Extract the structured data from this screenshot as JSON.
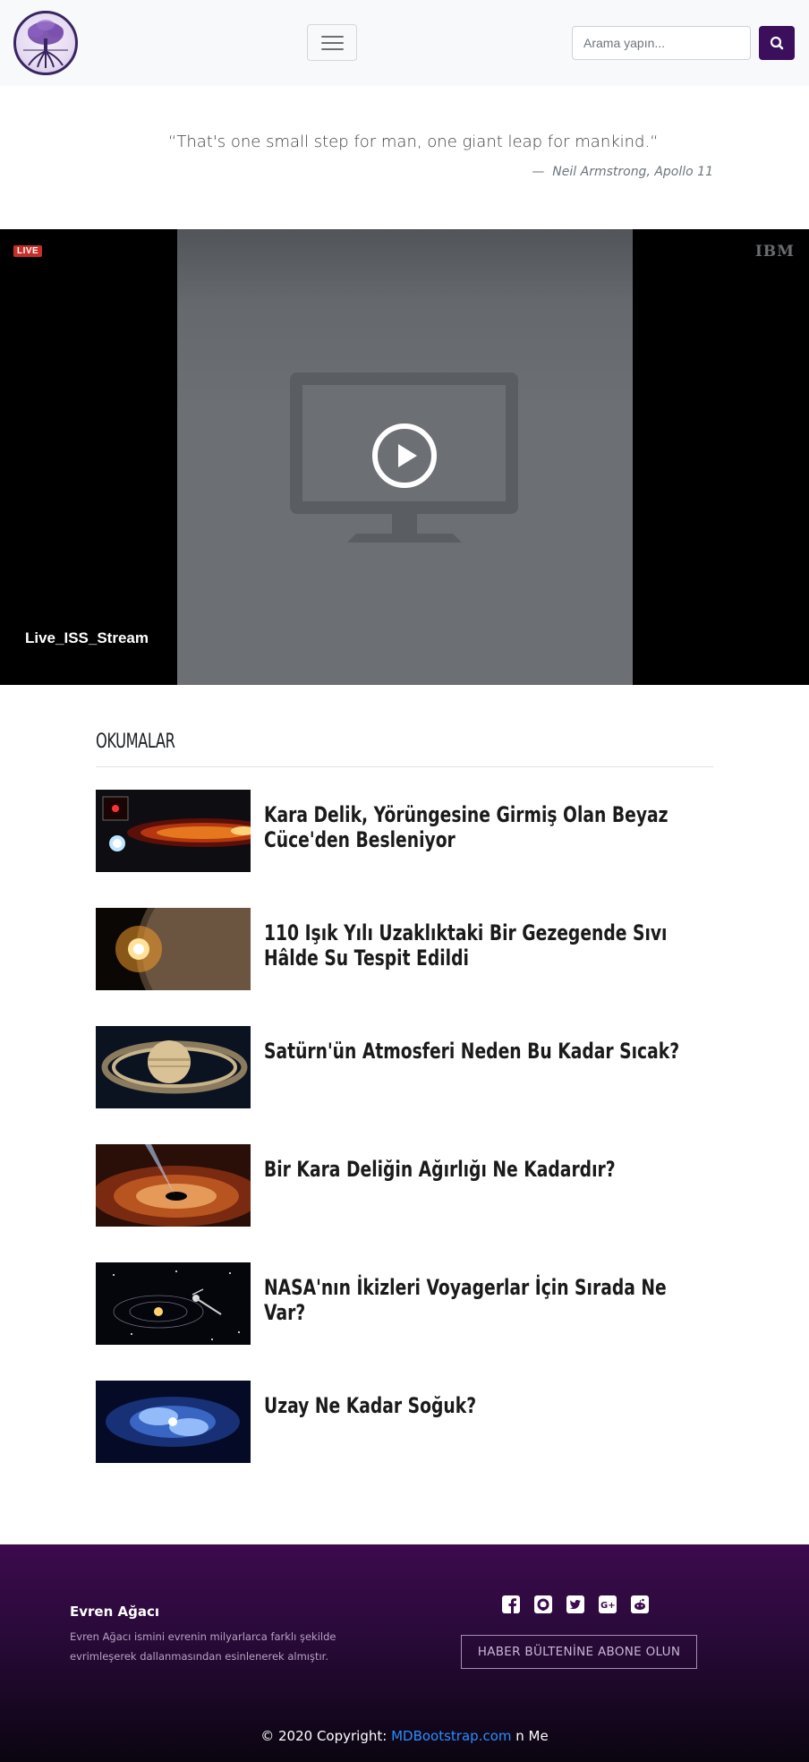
{
  "navbar": {
    "logo_alt": "Evren Ağacı",
    "search_placeholder": "Arama yapın..."
  },
  "quote": {
    "text": "“That's one small step for man, one giant leap for mankind.“",
    "dash": "—",
    "source": "Neil Armstrong, Apollo 11"
  },
  "video": {
    "live_label": "LIVE",
    "brand": "IBM",
    "stream_name": "Live_ISS_Stream"
  },
  "articles": {
    "heading": "OKUMALAR",
    "items": [
      {
        "title": "Kara Delik, Yörüngesine Girmiş Olan Beyaz Cüce'den Besleniyor",
        "thumb": "black-hole-white-dwarf"
      },
      {
        "title": "110 Işık Yılı Uzaklıktaki Bir Gezegende Sıvı Hâlde Su Tespit Edildi",
        "thumb": "exoplanet-sunrise"
      },
      {
        "title": "Satürn'ün Atmosferi Neden Bu Kadar Sıcak?",
        "thumb": "saturn"
      },
      {
        "title": "Bir Kara Deliğin Ağırlığı Ne Kadardır?",
        "thumb": "black-hole-accretion-disk"
      },
      {
        "title": "NASA'nın İkizleri Voyagerlar İçin Sırada Ne Var?",
        "thumb": "voyager-solar-system"
      },
      {
        "title": "Uzay Ne Kadar Soğuk?",
        "thumb": "boomerang-nebula"
      }
    ]
  },
  "footer": {
    "title": "Evren Ağacı",
    "description": "Evren Ağacı ismini evrenin milyarlarca farklı şekilde evrimleşerek dallanmasından esinlenerek almıştır.",
    "social_icons": [
      "facebook-icon",
      "github-icon",
      "twitter-icon",
      "google-plus-icon",
      "reddit-icon"
    ],
    "subscribe_label": "HABER BÜLTENİNE ABONE OLUN",
    "copyright_prefix": "© 2020 Copyright:",
    "copyright_link": "MDBootstrap.com",
    "copyright_suffix": "n Me"
  },
  "colors": {
    "brand_purple": "#3b0f5c",
    "live_red": "#c62f28",
    "footer_top": "#3c0a4d",
    "link_blue": "#2b8cff"
  }
}
